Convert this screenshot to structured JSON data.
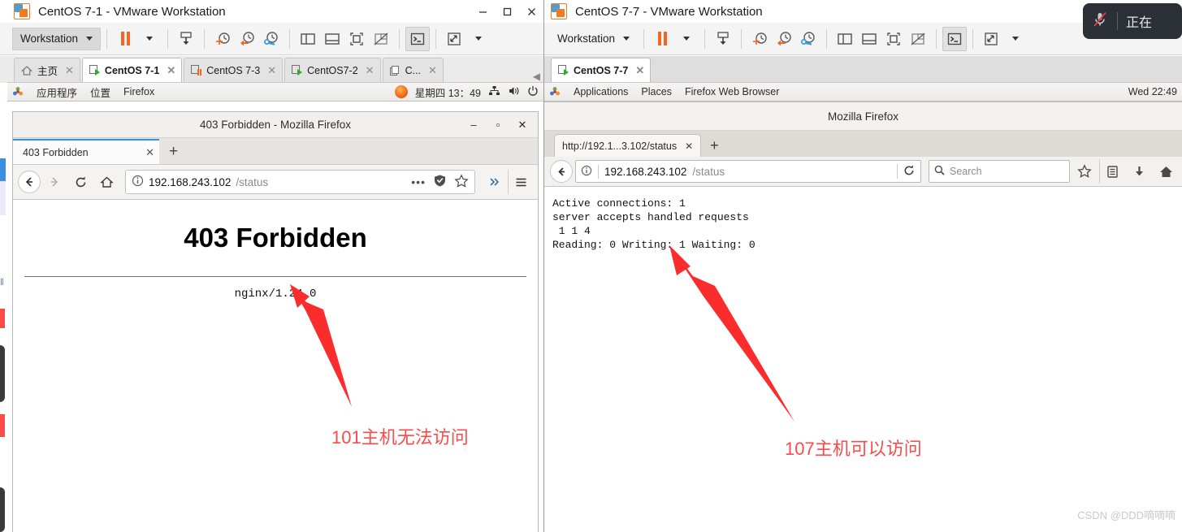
{
  "left_vm": {
    "window_title": "CentOS 7-1 - VMware Workstation",
    "app_logo": "vmware-logo-icon",
    "window_controls": {
      "minimize": "minimize-icon",
      "maximize": "maximize-icon",
      "close": "close-icon"
    },
    "toolbar": {
      "workstation_menu": "Workstation",
      "buttons": [
        {
          "name": "suspend-button",
          "icon": "pause-icon"
        },
        {
          "name": "suspend-dropdown",
          "icon": "chevron-down-icon"
        },
        {
          "name": "power-button",
          "icon": "power-down-icon"
        },
        {
          "name": "snapshot-take-button",
          "icon": "snapshot-add-icon"
        },
        {
          "name": "snapshot-revert-button",
          "icon": "snapshot-revert-icon"
        },
        {
          "name": "snapshot-manager-button",
          "icon": "snapshot-manage-icon"
        },
        {
          "name": "show-library-button",
          "icon": "panel-left-icon"
        },
        {
          "name": "show-thumbnail-button",
          "icon": "panel-bottom-icon"
        },
        {
          "name": "fullscreen-button",
          "icon": "fullscreen-icon"
        },
        {
          "name": "unity-button",
          "icon": "unity-off-icon"
        },
        {
          "name": "console-button",
          "icon": "terminal-icon"
        },
        {
          "name": "stretch-button",
          "icon": "expand-arrows-icon"
        },
        {
          "name": "stretch-dropdown",
          "icon": "chevron-down-icon"
        }
      ]
    },
    "vm_tabs": [
      {
        "label": "主页",
        "icon": "home-icon",
        "selected": false
      },
      {
        "label": "CentOS 7-1",
        "icon": "vm-running-icon",
        "selected": true
      },
      {
        "label": "CentOS 7-3",
        "icon": "vm-suspended-icon",
        "selected": false
      },
      {
        "label": "CentOS7-2",
        "icon": "vm-running-icon",
        "selected": false
      },
      {
        "label": "C...",
        "icon": "vm-stack-icon",
        "selected": false
      }
    ],
    "guest_panel": {
      "applications": "应用程序",
      "places": "位置",
      "app_name": "Firefox",
      "clock": "星期四 13：49",
      "tray_icons": [
        "network-icon",
        "volume-icon",
        "power-icon"
      ]
    },
    "firefox": {
      "window_title": "403 Forbidden - Mozilla Firefox",
      "tab_title": "403 Forbidden",
      "new_tab": "+",
      "nav_icons": [
        "back-icon",
        "forward-icon",
        "reload-icon",
        "home-icon"
      ],
      "url_host": "192.168.243.102",
      "url_path": "/status",
      "url_right_icons": [
        "page-actions-icon",
        "shield-icon",
        "bookmark-star-icon"
      ],
      "overflow_icon": "chevron-double-right-icon",
      "menu_icon": "hamburger-menu-icon",
      "page": {
        "heading": "403 Forbidden",
        "signature": "nginx/1.24.0"
      }
    },
    "annotation": {
      "text": "101主机无法访问",
      "color": "#fa4b4b",
      "arrow": "red-arrow-up-left"
    }
  },
  "right_vm": {
    "window_title": "CentOS 7-7 - VMware Workstation",
    "app_logo": "vmware-logo-icon",
    "toolbar": {
      "workstation_menu": "Workstation",
      "buttons": [
        {
          "name": "suspend-button",
          "icon": "pause-icon"
        },
        {
          "name": "suspend-dropdown",
          "icon": "chevron-down-icon"
        },
        {
          "name": "power-button",
          "icon": "power-down-icon"
        },
        {
          "name": "snapshot-take-button",
          "icon": "snapshot-add-icon"
        },
        {
          "name": "snapshot-revert-button",
          "icon": "snapshot-revert-icon"
        },
        {
          "name": "snapshot-manager-button",
          "icon": "snapshot-manage-icon"
        },
        {
          "name": "show-library-button",
          "icon": "panel-left-icon"
        },
        {
          "name": "show-thumbnail-button",
          "icon": "panel-bottom-icon"
        },
        {
          "name": "fullscreen-button",
          "icon": "fullscreen-icon"
        },
        {
          "name": "unity-button",
          "icon": "unity-off-icon"
        },
        {
          "name": "console-button",
          "icon": "terminal-icon"
        },
        {
          "name": "stretch-button",
          "icon": "expand-arrows-icon"
        },
        {
          "name": "stretch-dropdown",
          "icon": "chevron-down-icon"
        }
      ]
    },
    "vm_tabs": [
      {
        "label": "CentOS 7-7",
        "icon": "vm-running-icon",
        "selected": true
      }
    ],
    "guest_panel": {
      "applications": "Applications",
      "places": "Places",
      "app_name": "Firefox Web Browser",
      "clock": "Wed 22:49"
    },
    "firefox": {
      "window_title": "Mozilla Firefox",
      "tab_title": "http://192.1...3.102/status",
      "new_tab": "+",
      "url_host": "192.168.243.102",
      "url_path": "/status",
      "reload_icon": "reload-icon",
      "search_placeholder": "Search",
      "search_icon": "search-icon",
      "right_icons": [
        "bookmark-star-icon",
        "library-icon",
        "downloads-icon",
        "home-icon"
      ],
      "page_lines": [
        "Active connections: 1",
        "server accepts handled requests",
        " 1 1 4",
        "Reading: 0 Writing: 1 Waiting: 0"
      ]
    },
    "annotation": {
      "text": "107主机可以访问",
      "color": "#fa4b4b",
      "arrow": "red-arrow-up-left"
    }
  },
  "overlay": {
    "mic_icon": "microphone-muted-icon",
    "status_text": "正在"
  },
  "watermark": "CSDN @DDD嘀嘀嘀"
}
